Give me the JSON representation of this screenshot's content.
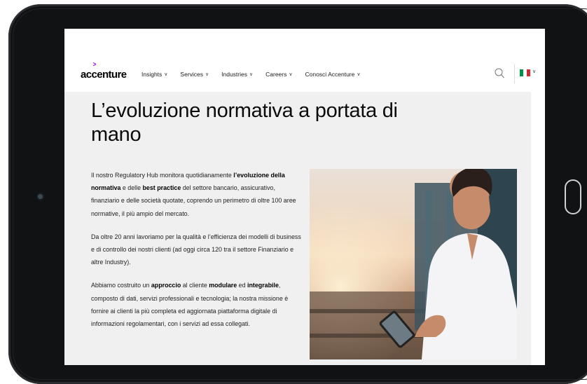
{
  "nav": {
    "logo": "accenture",
    "items": [
      {
        "label": "Insights"
      },
      {
        "label": "Services"
      },
      {
        "label": "Industries"
      },
      {
        "label": "Careers"
      },
      {
        "label": "Conosci Accenture"
      }
    ],
    "search_icon": "search-icon",
    "language_flag": "italy-flag",
    "flag_colors": [
      "#009246",
      "#ffffff",
      "#ce2b37"
    ]
  },
  "hero": {
    "title": "L’evoluzione normativa a portata di mano",
    "paragraph1": {
      "t1": "Il nostro Regulatory Hub monitora quotidianamente ",
      "b1": "l’evoluzione della normativa",
      "t2": " e delle ",
      "b2": "best practice",
      "t3": " del settore bancario, assicurativo, finanziario e delle società quotate, coprendo un perimetro di oltre 100 aree normative, il più ampio del mercato."
    },
    "paragraph2": "Da oltre 20 anni lavoriamo per la qualità e l’efficienza dei modelli di business e di controllo dei nostri clienti (ad oggi circa 120 tra il settore Finanziario e altre Industry).",
    "paragraph3": {
      "t1": "Abbiamo costruito un ",
      "b1": "approccio",
      "t2": " al cliente ",
      "b2": "modulare",
      "t3": " ed ",
      "b3": "integrabile",
      "t4": ", composto di dati, servizi professionali e tecnologia; la nostra missione è fornire ai clienti la più completa ed aggiornata piattaforma digitale di informazioni regolamentari, con i servizi ad essa collegati."
    }
  },
  "colors": {
    "accent": "#a100ff",
    "background": "#f0f0f0",
    "bezel": "#111214"
  }
}
